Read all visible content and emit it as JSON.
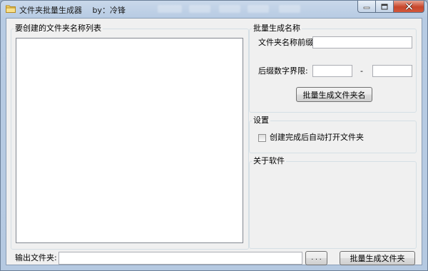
{
  "window": {
    "title": "文件夹批量生成器　 by：冷锋",
    "icon": "folder-icon",
    "caption_buttons": [
      "minimize-icon",
      "maximize-icon",
      "close-icon"
    ]
  },
  "list_panel": {
    "label": "要创建的文件夹名称列表",
    "items": []
  },
  "batch_name": {
    "label": "批量生成名称",
    "prefix_label": "文件夹名称前缀:",
    "prefix_value": "",
    "range_label": "后缀数字界限:",
    "range_start": "",
    "range_separator": "-",
    "range_end": "",
    "generate_button": "批量生成文件夹名"
  },
  "settings": {
    "label": "设置",
    "auto_open_label": "创建完成后自动打开文件夹",
    "auto_open_checked": false
  },
  "about": {
    "label": "关于软件"
  },
  "output": {
    "label": "输出文件夹:",
    "path_value": "",
    "browse_button": ". . .",
    "create_button": "批量生成文件夹"
  },
  "colors": {
    "title_bar": "#b7cbe3",
    "client_bg": "#f0f0f0",
    "close_button": "#c7462b"
  }
}
